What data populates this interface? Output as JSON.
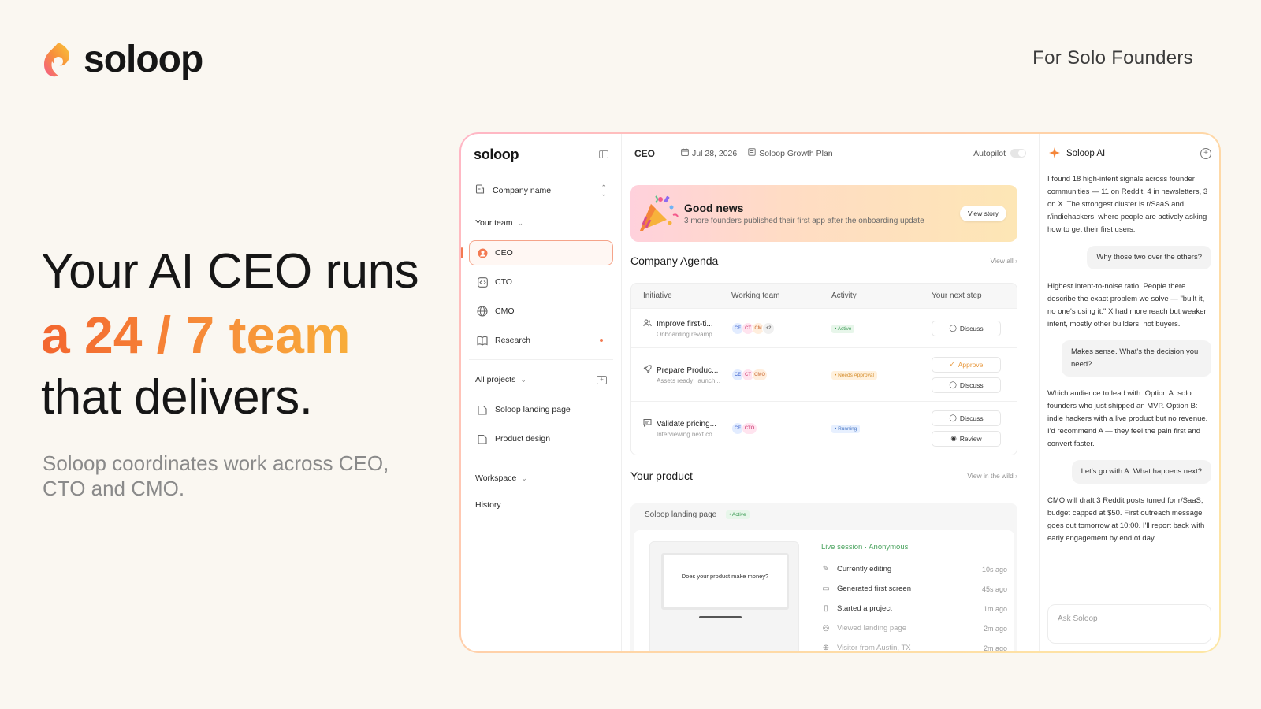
{
  "brand": {
    "logo_text": "soloop"
  },
  "tagline": "For Solo Founders",
  "hero": {
    "line1": "Your AI CEO runs",
    "line2": "a 24 / 7 team",
    "line3": "that delivers.",
    "subtitle": "Soloop coordinates work across CEO, CTO and CMO."
  },
  "colors": {
    "accent": "#f37a52",
    "gradient_start": "#f3662f",
    "gradient_end": "#f9c53b"
  },
  "sidebar": {
    "logo_text": "soloop",
    "company": "Company name",
    "team_label": "Your team",
    "team": [
      {
        "label": "CEO",
        "icon": "user-circle-icon"
      },
      {
        "label": "CTO",
        "icon": "code-icon"
      },
      {
        "label": "CMO",
        "icon": "globe-icon"
      },
      {
        "label": "Research",
        "icon": "book-icon"
      }
    ],
    "projects_label": "All projects",
    "projects": [
      "Soloop landing page",
      "Product design"
    ],
    "workspace_label": "Workspace",
    "history_label": "History"
  },
  "topbar": {
    "crumb": "CEO",
    "date": "Jul 28, 2026",
    "plan": "Soloop Growth Plan",
    "autopilot": "Autopilot"
  },
  "banner": {
    "title": "Good news",
    "text": "3 more founders published their first app after the onboarding update",
    "button": "View story"
  },
  "agenda": {
    "title": "Company Agenda",
    "link": "View all",
    "columns": [
      "Initiative",
      "Working team",
      "Activity",
      "Your next step"
    ],
    "rows": [
      {
        "title": "Improve first-ti...",
        "sub": "Onboarding revamp...",
        "team": [
          "CE",
          "CT",
          "CM",
          "+2"
        ],
        "status": "• Active",
        "actions": [
          "Discuss"
        ]
      },
      {
        "title": "Prepare Produc...",
        "sub": "Assets ready; launch...",
        "team": [
          "CE",
          "CT",
          "CMO"
        ],
        "status": "• Needs Approval",
        "actions": [
          "Approve",
          "Discuss"
        ]
      },
      {
        "title": "Validate pricing...",
        "sub": "Interviewing next co...",
        "team": [
          "CE",
          "CTO"
        ],
        "status": "• Running",
        "actions": [
          "Discuss",
          "Review"
        ]
      }
    ]
  },
  "product": {
    "title": "Your product",
    "link": "View in the wild",
    "name": "Soloop landing page",
    "status": "• Active",
    "preview_text": "Does your product make money?",
    "session_label": "Live session · Anonymous",
    "activity": [
      {
        "label": "Currently editing",
        "time": "10s ago"
      },
      {
        "label": "Generated first screen",
        "time": "45s ago"
      },
      {
        "label": "Started a project",
        "time": "1m ago"
      },
      {
        "label": "Viewed landing page",
        "time": "2m ago"
      },
      {
        "label": "Visitor from Austin, TX",
        "time": "2m ago"
      }
    ]
  },
  "chat": {
    "title": "Soloop AI",
    "messages": [
      {
        "role": "ai",
        "text": "I found 18 high-intent signals across founder communities — 11 on Reddit, 4 in newsletters, 3 on X. The strongest cluster is r/SaaS and r/indiehackers, where people are actively asking how to get their first users."
      },
      {
        "role": "user",
        "text": "Why those two over the others?"
      },
      {
        "role": "ai",
        "text": "Highest intent-to-noise ratio. People there describe the exact problem we solve — \"built it, no one's using it.\" X had more reach but weaker intent, mostly other builders, not buyers."
      },
      {
        "role": "user",
        "text": "Makes sense. What's the decision you need?"
      },
      {
        "role": "ai",
        "text": "Which audience to lead with. Option A: solo founders who just shipped an MVP. Option B: indie hackers with a live product but no revenue. I'd recommend A — they feel the pain first and convert faster."
      },
      {
        "role": "user",
        "text": "Let's go with A. What happens next?"
      },
      {
        "role": "ai",
        "text": "CMO will draft 3 Reddit posts tuned for r/SaaS, budget capped at $50. First outreach message goes out tomorrow at 10:00. I'll report back with early engagement by end of day."
      }
    ],
    "input_placeholder": "Ask Soloop"
  }
}
